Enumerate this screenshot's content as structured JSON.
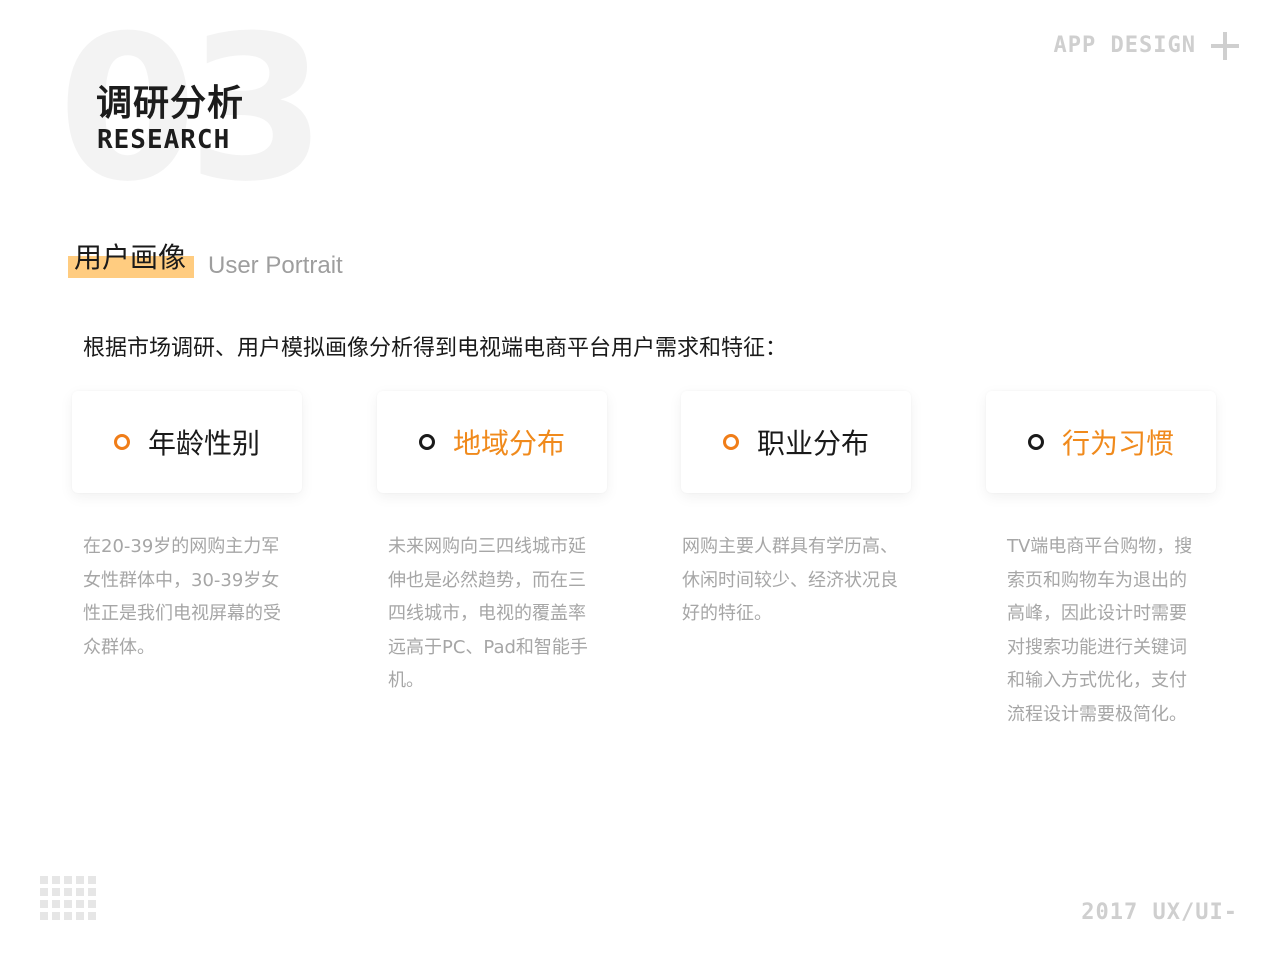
{
  "header": {
    "section_number": "03",
    "title_cn": "调研分析",
    "title_en": "RESEARCH",
    "brand": "APP DESIGN"
  },
  "section": {
    "title_cn": "用户画像",
    "title_en": "User Portrait"
  },
  "intro": "根据市场调研、用户模拟画像分析得到电视端电商平台用户需求和特征：",
  "cards": [
    {
      "label": "年龄性别",
      "icon": "ring-orange-icon"
    },
    {
      "label": "地域分布",
      "icon": "ring-dark-icon"
    },
    {
      "label": "职业分布",
      "icon": "ring-orange-icon"
    },
    {
      "label": "行为习惯",
      "icon": "ring-dark-icon"
    }
  ],
  "descriptions": [
    [
      "在20-39岁的网购主力军",
      "女性群体中，30-39岁女",
      "性正是我们电视屏幕的受",
      "众群体。"
    ],
    [
      "未来网购向三四线城市延",
      "伸也是必然趋势，而在三",
      "四线城市，电视的覆盖率",
      "远高于PC、Pad和智能手",
      "机。"
    ],
    [
      "网购主要人群具有学历高、",
      "休闲时间较少、经济状况良",
      "好的特征。"
    ],
    [
      "TV端电商平台购物，搜",
      "索页和购物车为退出的",
      "高峰，因此设计时需要",
      "对搜索功能进行关键词",
      "和输入方式优化，支付",
      "流程设计需要极简化。"
    ]
  ],
  "footer": "2017 UX/UI-",
  "colors": {
    "accent": "#f08a1c",
    "highlight": "#ffcc80",
    "muted": "#a6a6a6",
    "watermark": "#f3f3f3"
  }
}
